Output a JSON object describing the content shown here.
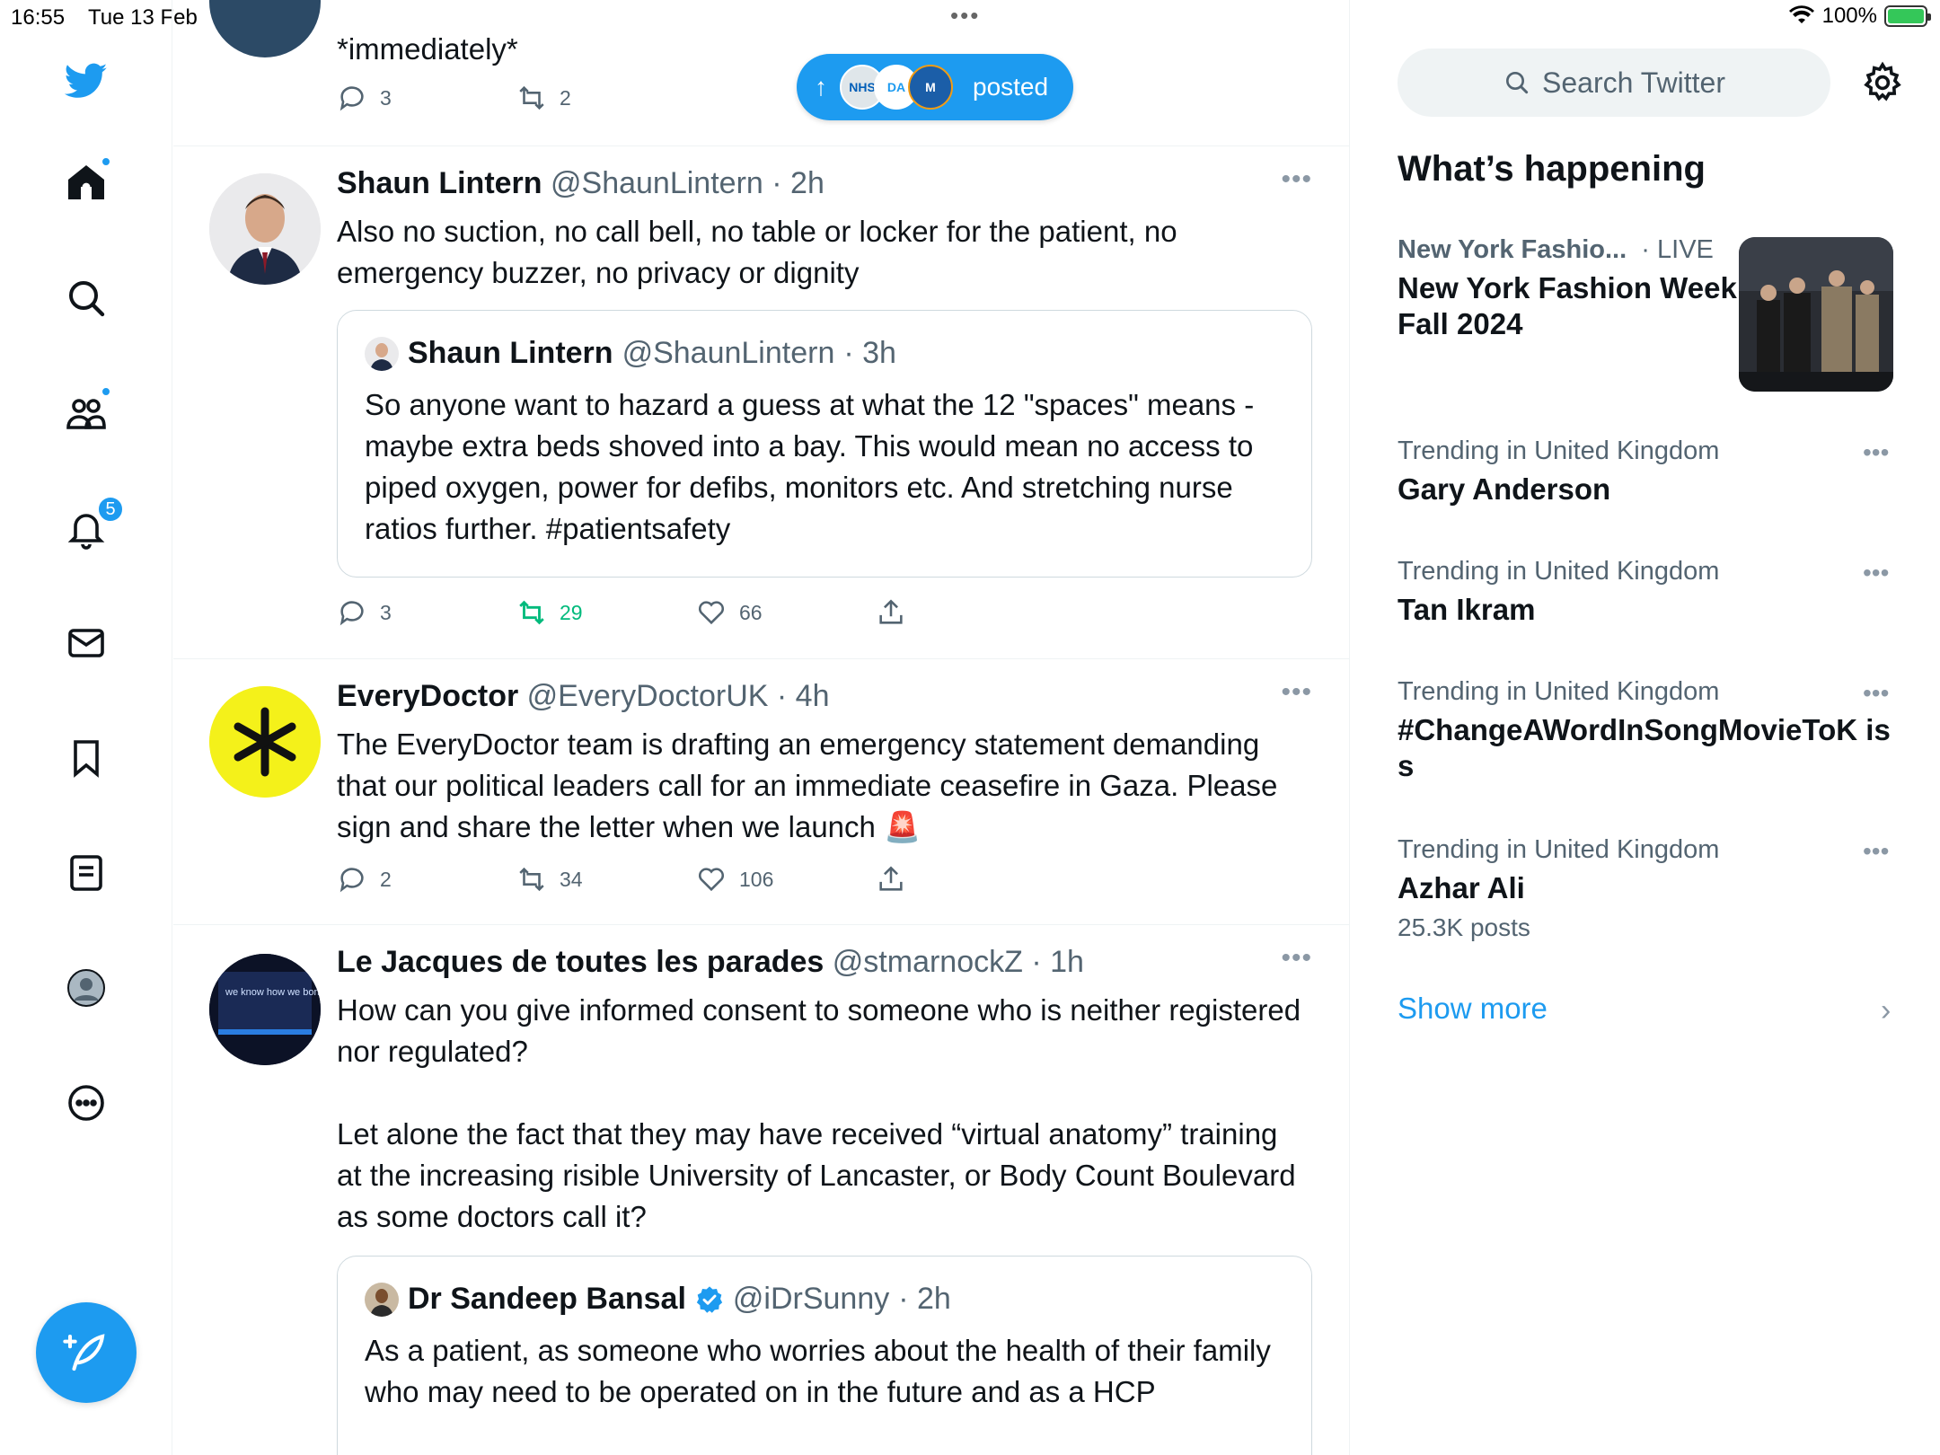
{
  "status_bar": {
    "time": "16:55",
    "date": "Tue 13 Feb",
    "battery": "100%"
  },
  "nav": {
    "notifications_count": "5"
  },
  "posted_pill": {
    "label": "posted",
    "avatars": [
      "NHS",
      "DA",
      "M"
    ]
  },
  "tweets": [
    {
      "text": "*immediately*",
      "replies": "3",
      "retweets": "2"
    },
    {
      "name": "Shaun Lintern",
      "handle": "@ShaunLintern",
      "time": "· 2h",
      "text": "Also no suction, no call bell, no table or locker for the patient, no emergency buzzer, no privacy or dignity",
      "quote": {
        "name": "Shaun Lintern",
        "handle": "@ShaunLintern",
        "time": "· 3h",
        "text": "So anyone want to hazard a guess at what the 12 \"spaces\" means - maybe extra beds shoved into a bay. This would mean no access to piped oxygen, power for defibs, monitors etc. And stretching nurse ratios further. #patientsafety"
      },
      "replies": "3",
      "retweets": "29",
      "likes": "66"
    },
    {
      "name": "EveryDoctor",
      "handle": "@EveryDoctorUK",
      "time": "· 4h",
      "text": "The EveryDoctor team is drafting an emergency statement demanding that our political leaders call for an immediate ceasefire in Gaza. Please sign and share the letter when we launch 🚨",
      "replies": "2",
      "retweets": "34",
      "likes": "106"
    },
    {
      "name": "Le Jacques de toutes les parades",
      "handle": "@stmarnockZ",
      "time": "· 1h",
      "text": "How can you give informed consent to someone who is neither registered nor regulated?\n\nLet alone the fact that they may have received “virtual anatomy” training at the increasing risible University of Lancaster, or Body Count Boulevard as some doctors call it?",
      "avatar_text": "we know how we bond too",
      "quote": {
        "name": "Dr Sandeep Bansal",
        "handle": "@iDrSunny",
        "time": "· 2h",
        "text": "As a patient, as someone who worries about the health of their family who may need to be operated on in the future and as a HCP"
      }
    }
  ],
  "sidebar": {
    "search_placeholder": "Search Twitter",
    "section_title": "What’s happening",
    "featured": {
      "category": "New York Fashio...",
      "live": "· LIVE",
      "title": "New York Fashion Week Fall 2024"
    },
    "trends": [
      {
        "meta": "Trending in United Kingdom",
        "title": "Gary Anderson"
      },
      {
        "meta": "Trending in United Kingdom",
        "title": "Tan Ikram"
      },
      {
        "meta": "Trending in United Kingdom",
        "title": "#ChangeAWordInSongMovieToK iss"
      },
      {
        "meta": "Trending in United Kingdom",
        "title": "Azhar Ali",
        "count": "25.3K posts"
      }
    ],
    "show_more": "Show more"
  },
  "colors": {
    "accent": "#1d9bf0",
    "retweet_active": "#00ba7c",
    "secondary_text": "#536471"
  }
}
